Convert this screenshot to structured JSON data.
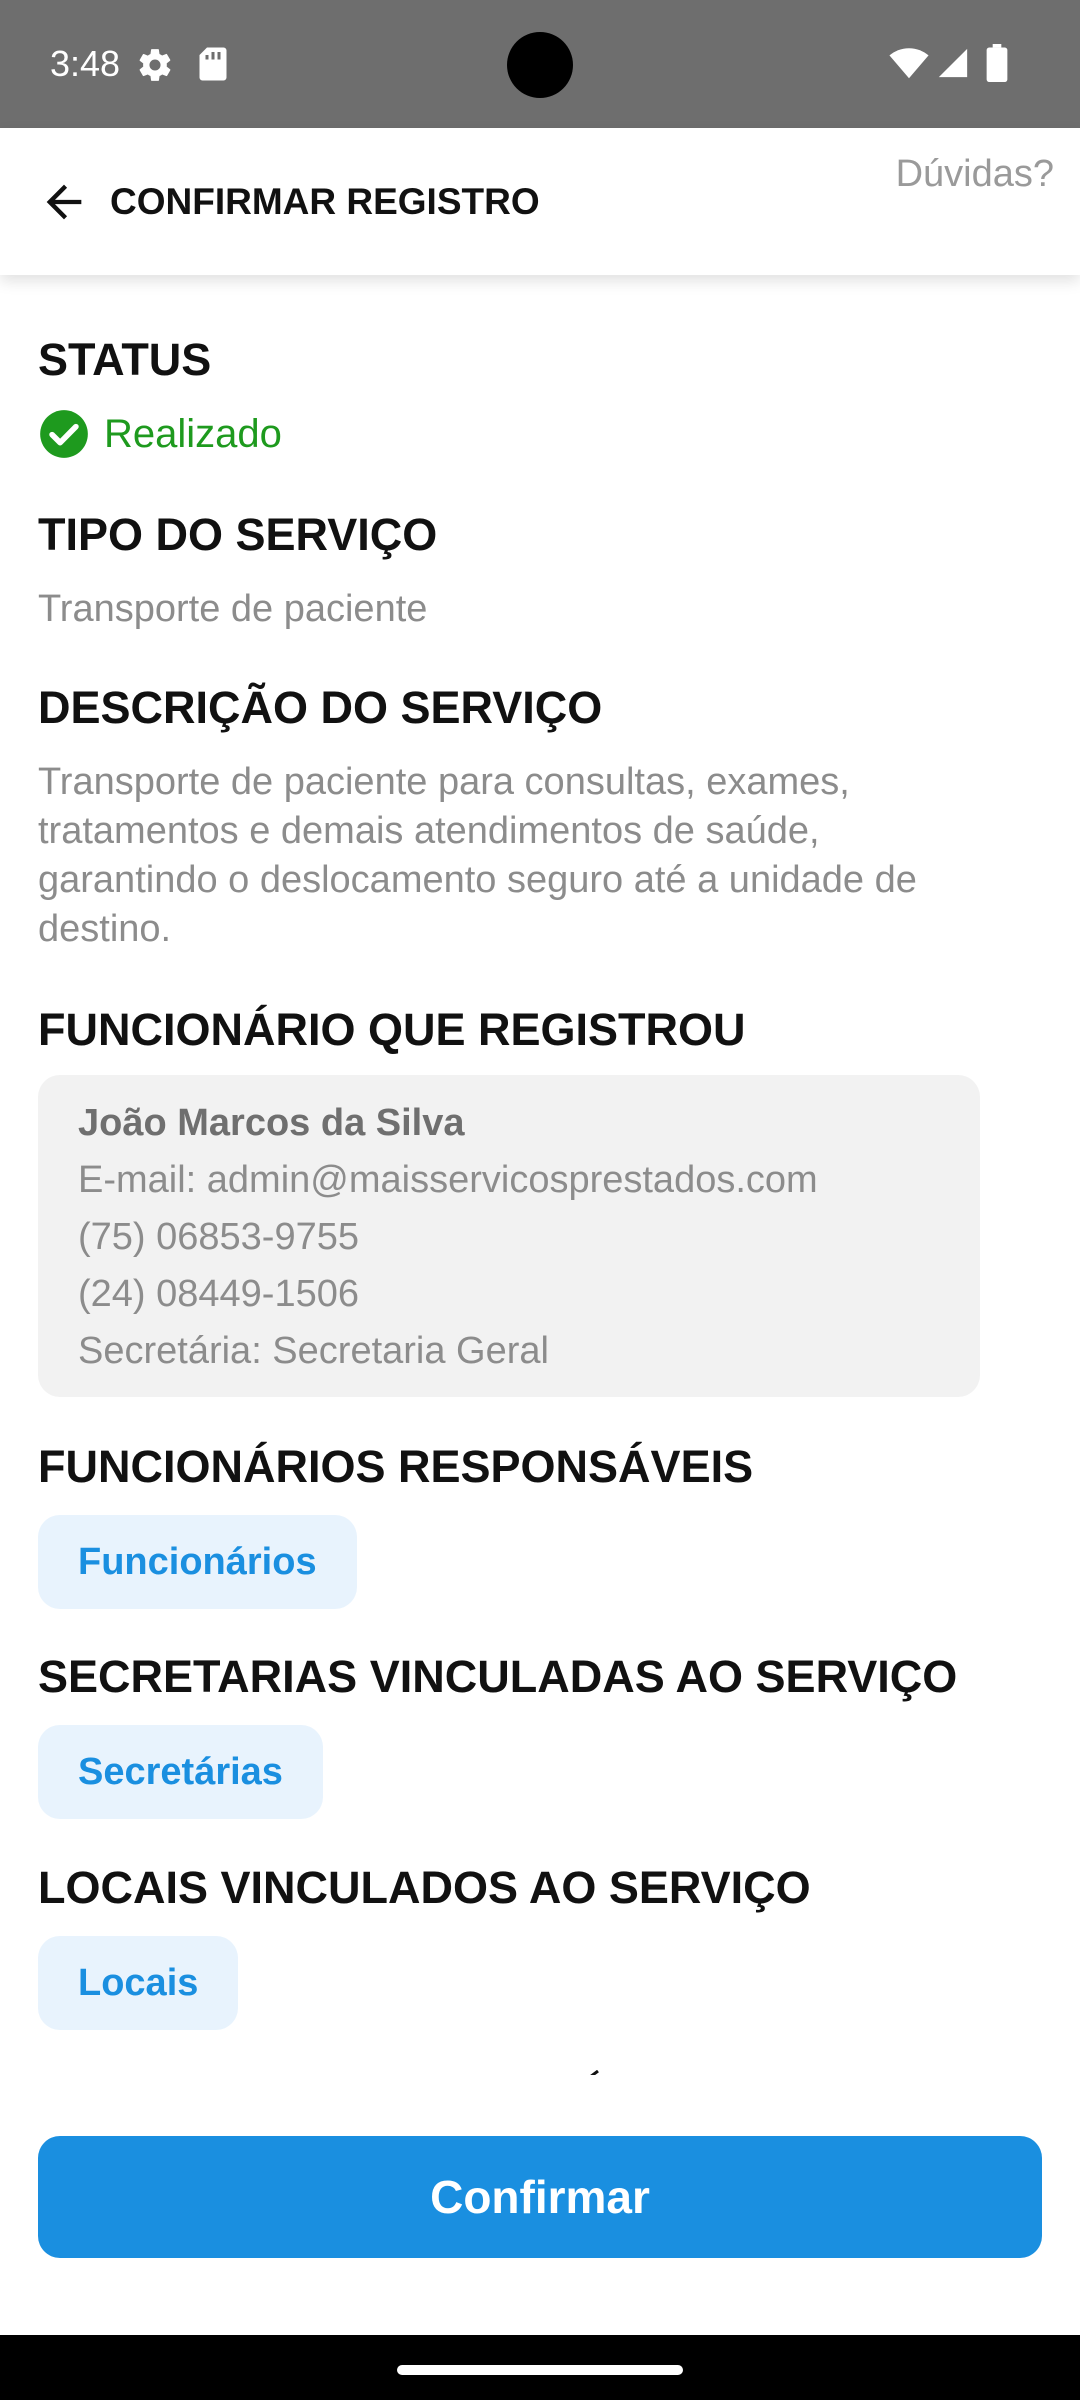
{
  "status_bar": {
    "time": "3:48",
    "icons": [
      "gear-icon",
      "sd-card-icon",
      "wifi-icon",
      "signal-icon",
      "battery-icon"
    ]
  },
  "header": {
    "back_icon": "arrow-left-icon",
    "title": "CONFIRMAR REGISTRO",
    "help_label": "Dúvidas?"
  },
  "sections": {
    "status": {
      "heading": "STATUS",
      "value": "Realizado",
      "icon": "check-circle-icon",
      "color": "#1e9a1e"
    },
    "service_type": {
      "heading": "TIPO DO SERVIÇO",
      "value": "Transporte de paciente"
    },
    "service_description": {
      "heading": "DESCRIÇÃO DO SERVIÇO",
      "lines": [
        "Transporte de paciente para consultas, exames,",
        "tratamentos e demais atendimentos de saúde,",
        "garantindo o deslocamento seguro até a unidade de",
        "destino."
      ]
    },
    "registered_by": {
      "heading": "FUNCIONÁRIO QUE REGISTROU",
      "name": "João Marcos da Silva",
      "email": "E-mail: admin@maisservicosprestados.com",
      "phone_1": "(75) 06853-9755",
      "phone_2": "(24) 08449-1506",
      "department": "Secretária: Secretaria Geral"
    },
    "responsible_staff": {
      "heading": "FUNCIONÁRIOS RESPONSÁVEIS",
      "button": "Funcionários"
    },
    "linked_departments": {
      "heading": "SECRETARIAS VINCULADAS AO SERVIÇO",
      "button": "Secretárias"
    },
    "linked_locations": {
      "heading": "LOCAIS VINCULADOS AO SERVIÇO",
      "button": "Locais"
    }
  },
  "footer": {
    "confirm_label": "Confirmar"
  },
  "colors": {
    "accent": "#1a8fe0",
    "chip_background": "#e8f3fd",
    "status_bar": "#6e6e6e",
    "success": "#1e9a1e",
    "muted_text": "#8c8c8c"
  }
}
